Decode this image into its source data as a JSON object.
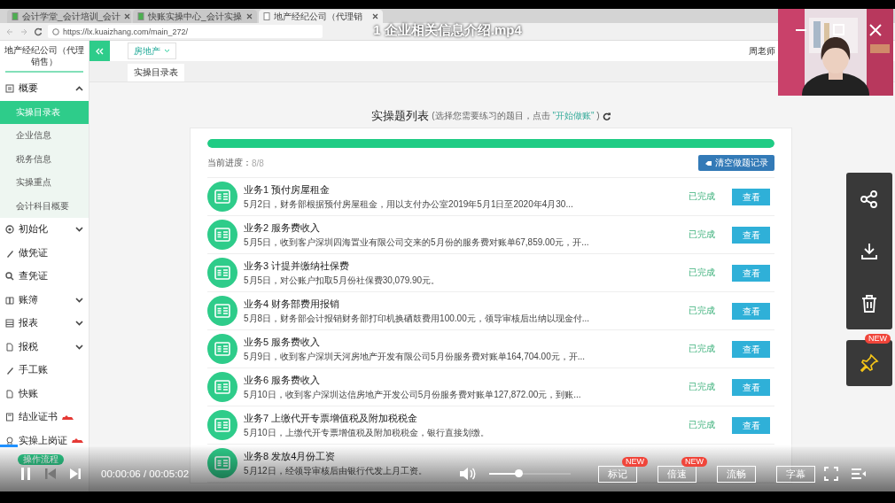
{
  "player": {
    "title": "1 企业相关信息介绍.mp4",
    "time": "00:00:06 / 00:05:02",
    "progress": {
      "level": 0.02
    },
    "volume": {
      "level": 0.36
    },
    "playing": true,
    "buttons": [
      {
        "label": "标记",
        "badge": "NEW"
      },
      {
        "label": "倍速",
        "badge": "NEW"
      },
      {
        "label": "流畅"
      },
      {
        "label": "字幕"
      }
    ],
    "side_tools": [
      {
        "kind": "share"
      },
      {
        "kind": "download"
      },
      {
        "kind": "delete"
      }
    ],
    "pin": {
      "badge": "NEW"
    }
  },
  "recording": {
    "browser": {
      "tabs": [
        {
          "label": "会计学堂_会计培训_会计",
          "selected": false
        },
        {
          "label": "快账实操中心_会计实操",
          "selected": false
        },
        {
          "label": "地产经纪公司（代理销",
          "selected": true
        }
      ],
      "address": "https://lx.kuaizhang.com/main_272/"
    },
    "sidebar": {
      "company": "地产经纪公司（代理销售）",
      "items": [
        {
          "label": "概要",
          "kind": "grid",
          "expanded": true,
          "children": [
            {
              "label": "实操目录表",
              "selected": true
            },
            {
              "label": "企业信息",
              "selected": false
            },
            {
              "label": "税务信息",
              "selected": false
            },
            {
              "label": "实操重点",
              "selected": false
            },
            {
              "label": "会计科目概要",
              "selected": false
            }
          ]
        },
        {
          "label": "初始化",
          "kind": "gear",
          "expanded": false
        },
        {
          "label": "做凭证",
          "kind": "pen"
        },
        {
          "label": "查凭证",
          "kind": "search"
        },
        {
          "label": "账簿",
          "kind": "book",
          "expanded": false
        },
        {
          "label": "报表",
          "kind": "table",
          "expanded": false
        },
        {
          "label": "报税",
          "kind": "file",
          "expanded": false
        },
        {
          "label": "手工账",
          "kind": "pen"
        },
        {
          "label": "快账",
          "kind": "file"
        },
        {
          "label": "结业证书",
          "kind": "doc",
          "hot": true
        },
        {
          "label": "实操上岗证",
          "kind": "badge",
          "hot": true
        }
      ],
      "flow_badge": "操作流程"
    },
    "header": {
      "industry": "房地产",
      "tab": "实操目录表",
      "user": "周老师"
    },
    "list": {
      "title": "实操题列表",
      "hint": "(选择您需要练习的题目，点击",
      "hint_link": "\"开始做账\"",
      "hint_end": ")",
      "progress": {
        "level": 1
      },
      "progress_label": "当前进度：",
      "progress_value": "8/8",
      "clear_button": "清空做题记录",
      "rows": [
        {
          "title": "业务1 预付房屋租金",
          "desc": "5月2日，财务部根据预付房屋租金，用以支付办公室2019年5月1日至2020年4月30...",
          "status": "已完成",
          "action": "查看"
        },
        {
          "title": "业务2 服务费收入",
          "desc": "5月5日，收到客户深圳四海置业有限公司交来的5月份的服务费对账单67,859.00元，开...",
          "status": "已完成",
          "action": "查看"
        },
        {
          "title": "业务3 计提并缴纳社保费",
          "desc": "5月5日，对公账户扣取5月份社保费30,079.90元。",
          "status": "已完成",
          "action": "查看"
        },
        {
          "title": "业务4 财务部费用报销",
          "desc": "5月8日，财务部会计报销财务部打印机换硒鼓费用100.00元，领导审核后出纳以现金付...",
          "status": "已完成",
          "action": "查看"
        },
        {
          "title": "业务5 服务费收入",
          "desc": "5月9日，收到客户深圳天河房地产开发有限公司5月份服务费对账单164,704.00元，开...",
          "status": "已完成",
          "action": "查看"
        },
        {
          "title": "业务6 服务费收入",
          "desc": "5月10日，收到客户深圳达信房地产开发公司5月份服务费对账单127,872.00元，到账...",
          "status": "已完成",
          "action": "查看"
        },
        {
          "title": "业务7 上缴代开专票增值税及附加税税金",
          "desc": "5月10日，上缴代开专票增值税及附加税税金，银行直接划缴。",
          "status": "已完成",
          "action": "查看"
        },
        {
          "title": "业务8 发放4月份工资",
          "desc": "5月12日，经领导审核后由银行代发上月工资。"
        }
      ]
    }
  }
}
